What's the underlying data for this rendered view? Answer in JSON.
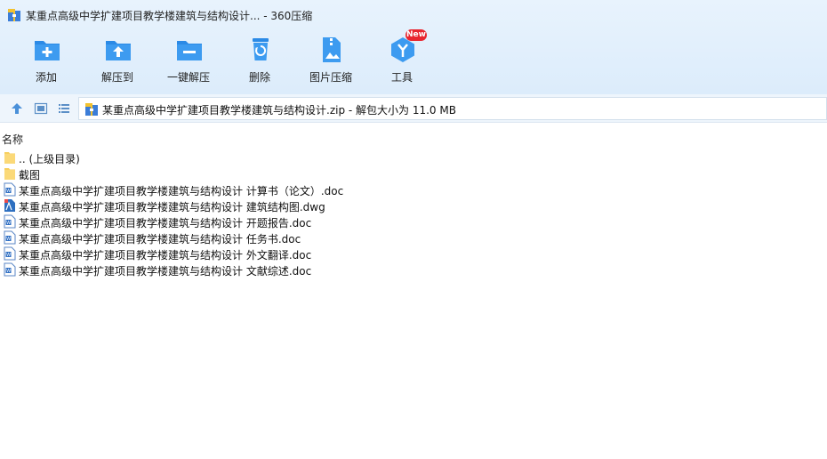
{
  "window": {
    "title": "某重点高级中学扩建项目教学楼建筑与结构设计... - 360压缩"
  },
  "toolbar": {
    "buttons": [
      {
        "label": "添加",
        "icon": "add-folder-icon"
      },
      {
        "label": "解压到",
        "icon": "extract-to-icon"
      },
      {
        "label": "一键解压",
        "icon": "one-click-extract-icon"
      },
      {
        "label": "删除",
        "icon": "delete-icon"
      },
      {
        "label": "图片压缩",
        "icon": "image-compress-icon"
      },
      {
        "label": "工具",
        "icon": "tools-icon"
      }
    ],
    "new_badge": "New"
  },
  "address": {
    "path": "某重点高级中学扩建项目教学楼建筑与结构设计.zip - 解包大小为 11.0 MB"
  },
  "list": {
    "column_name": "名称",
    "items": [
      {
        "name": ".. (上级目录)",
        "type": "folder"
      },
      {
        "name": "截图",
        "type": "folder"
      },
      {
        "name": "某重点高级中学扩建项目教学楼建筑与结构设计 计算书（论文）.doc",
        "type": "doc"
      },
      {
        "name": "某重点高级中学扩建项目教学楼建筑与结构设计 建筑结构图.dwg",
        "type": "dwg"
      },
      {
        "name": "某重点高级中学扩建项目教学楼建筑与结构设计 开题报告.doc",
        "type": "doc"
      },
      {
        "name": "某重点高级中学扩建项目教学楼建筑与结构设计 任务书.doc",
        "type": "doc"
      },
      {
        "name": "某重点高级中学扩建项目教学楼建筑与结构设计 外文翻译.doc",
        "type": "doc"
      },
      {
        "name": "某重点高级中学扩建项目教学楼建筑与结构设计 文献综述.doc",
        "type": "doc"
      }
    ]
  },
  "colors": {
    "accent": "#1e88e5",
    "badge": "#e8262f",
    "folder": "#f7cf5e"
  }
}
